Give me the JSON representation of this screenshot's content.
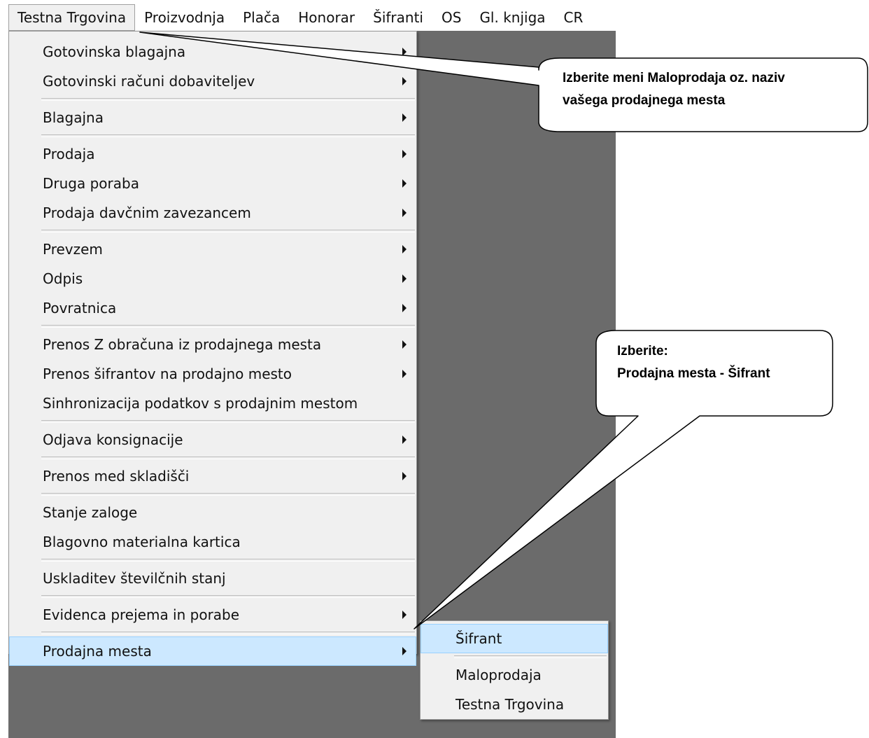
{
  "menubar": {
    "items": [
      {
        "label": "Testna Trgovina"
      },
      {
        "label": "Proizvodnja"
      },
      {
        "label": "Plača"
      },
      {
        "label": "Honorar"
      },
      {
        "label": "Šifranti"
      },
      {
        "label": "OS"
      },
      {
        "label": "Gl. knjiga"
      },
      {
        "label": "CR"
      }
    ]
  },
  "menu": {
    "items": [
      {
        "label": "Gotovinska blagajna"
      },
      {
        "label": "Gotovinski računi dobaviteljev"
      },
      {
        "label": "Blagajna"
      },
      {
        "label": "Prodaja"
      },
      {
        "label": "Druga poraba"
      },
      {
        "label": "Prodaja davčnim zavezancem"
      },
      {
        "label": "Prevzem"
      },
      {
        "label": "Odpis"
      },
      {
        "label": "Povratnica"
      },
      {
        "label": "Prenos Z obračuna iz prodajnega mesta"
      },
      {
        "label": "Prenos šifrantov na prodajno mesto"
      },
      {
        "label": "Sinhronizacija podatkov s prodajnim mestom"
      },
      {
        "label": "Odjava konsignacije"
      },
      {
        "label": "Prenos med skladišči"
      },
      {
        "label": "Stanje zaloge"
      },
      {
        "label": "Blagovno materialna kartica"
      },
      {
        "label": "Uskladitev številčnih stanj"
      },
      {
        "label": "Evidenca prejema in porabe"
      },
      {
        "label": "Prodajna mesta"
      }
    ]
  },
  "submenu": {
    "items": [
      {
        "label": "Šifrant"
      },
      {
        "label": "Maloprodaja"
      },
      {
        "label": "Testna Trgovina"
      }
    ]
  },
  "callouts": {
    "top": {
      "line1": "Izberite meni  Maloprodaja oz. naziv",
      "line2": "vašega prodajnega mesta"
    },
    "bottom": {
      "line1": "Izberite:",
      "line2": "Prodajna mesta - Šifrant"
    }
  },
  "colors": {
    "workspace": "#6b6b6b",
    "menu_bg": "#f0f0f0",
    "highlight": "#cce8ff",
    "highlight_border": "#99d1ff"
  }
}
